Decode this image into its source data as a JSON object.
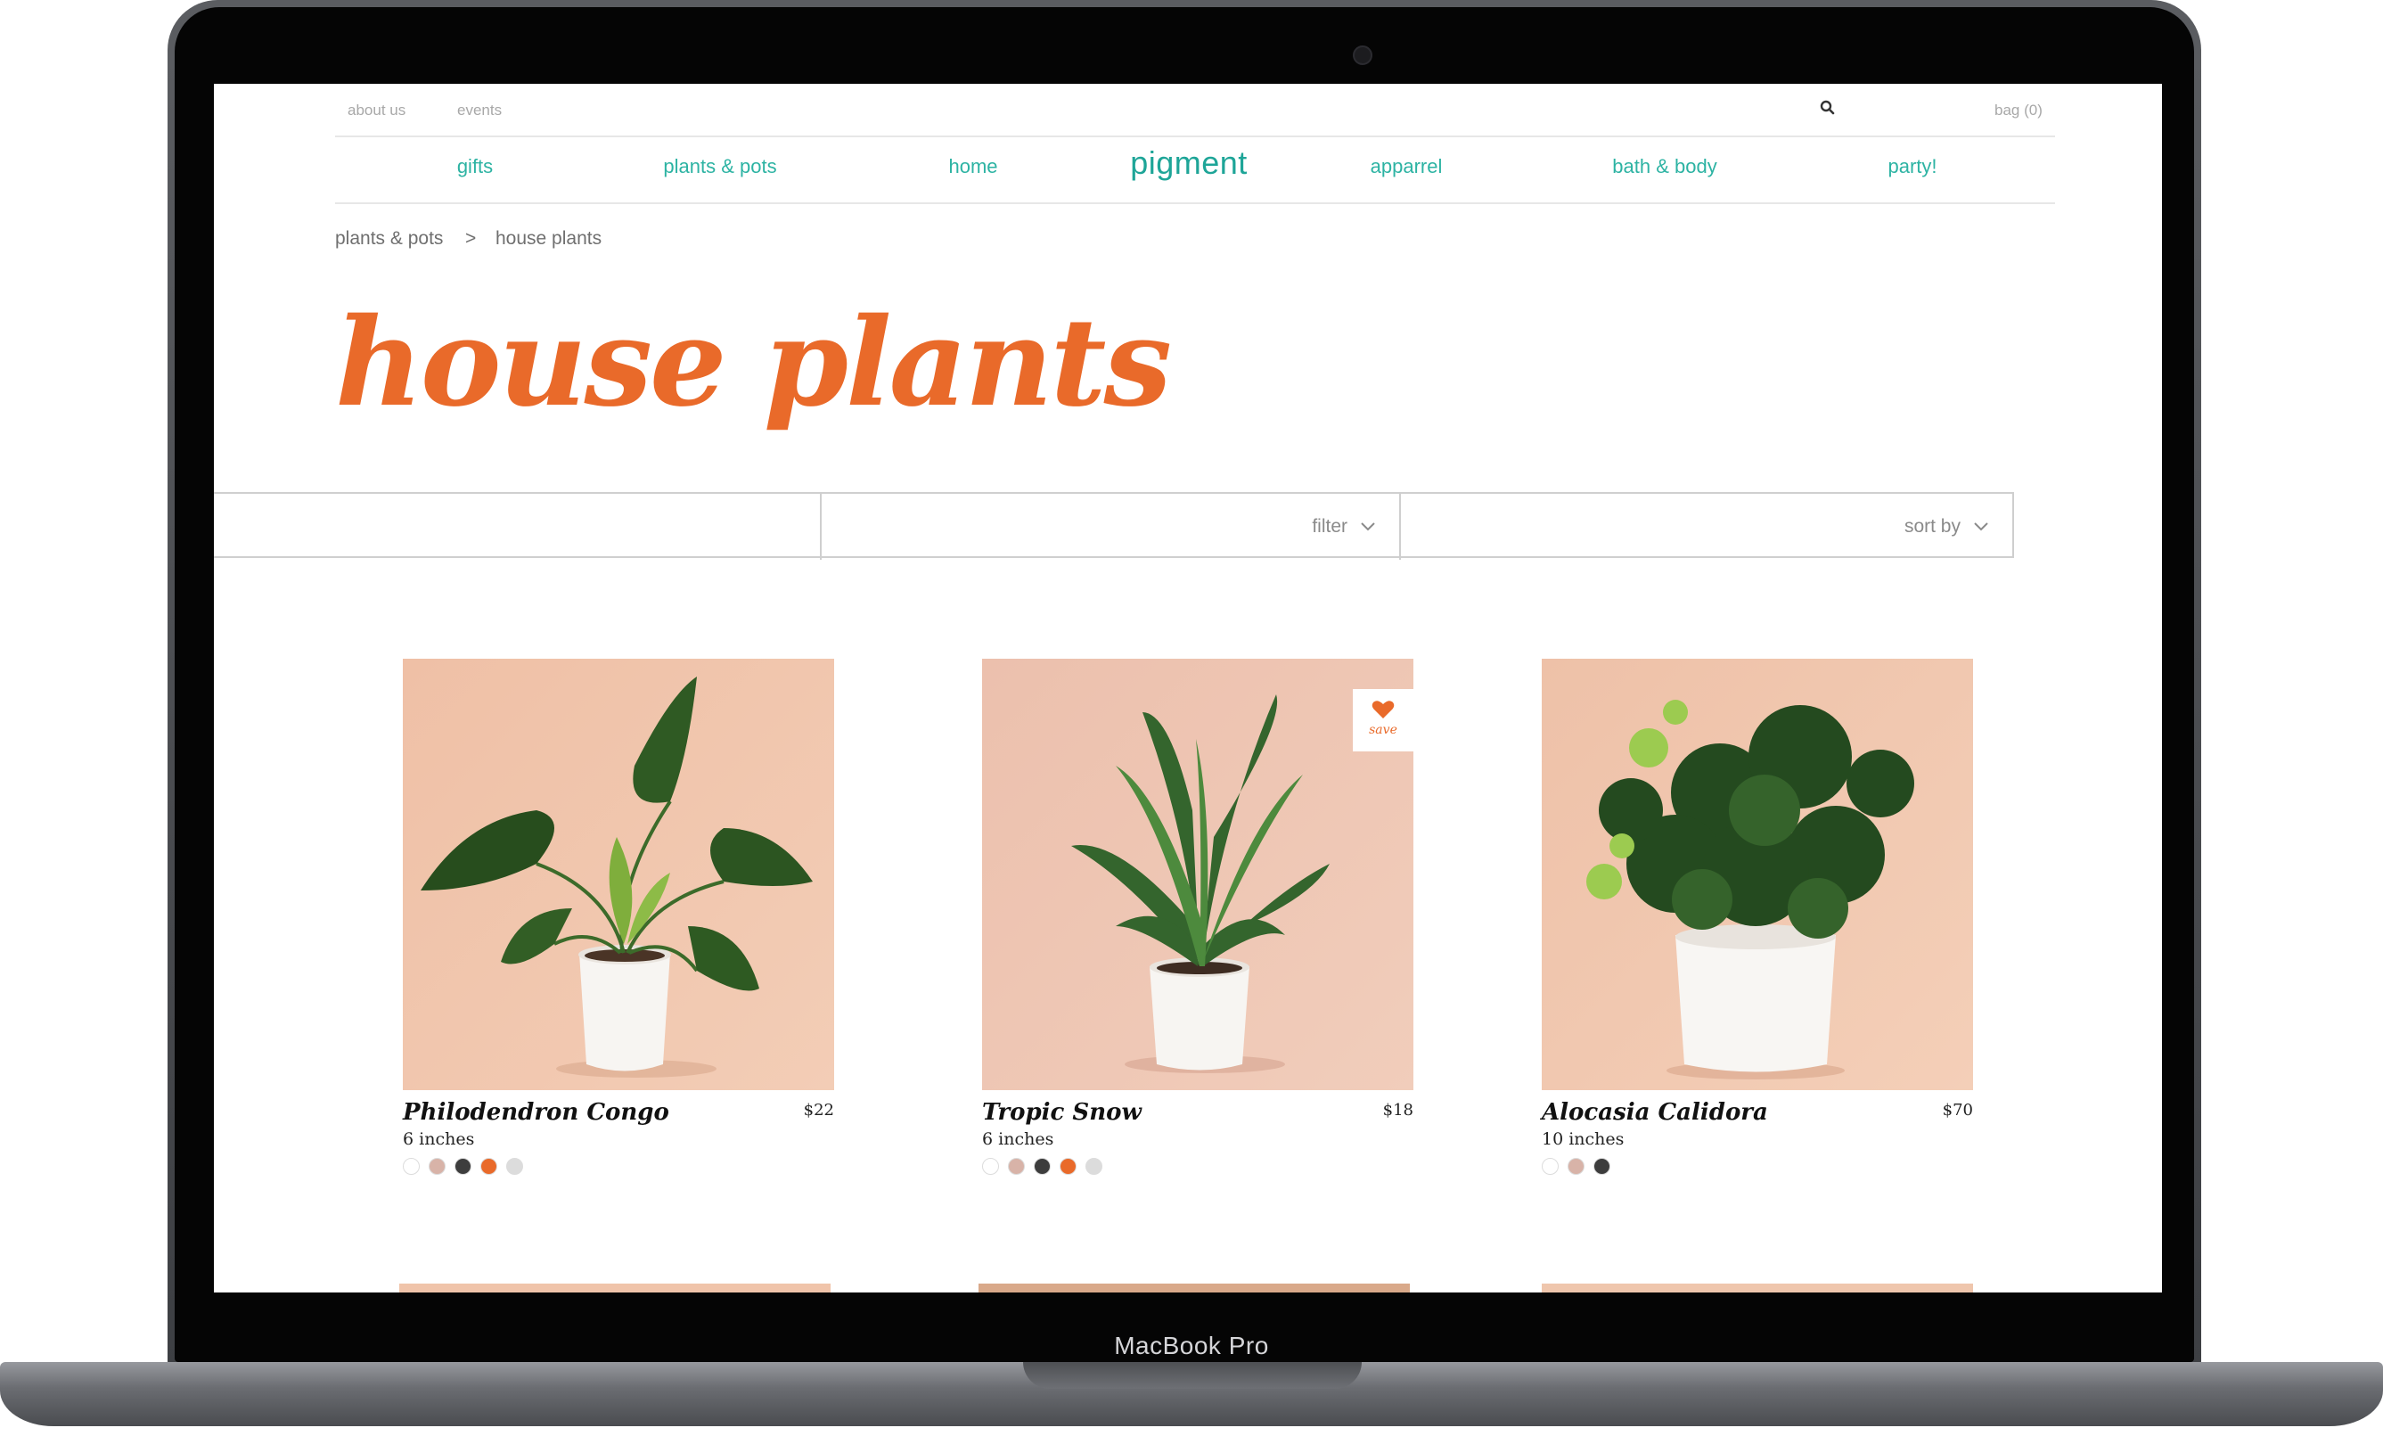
{
  "device": {
    "label": "MacBook Pro"
  },
  "utility_nav": {
    "about_label": "about us",
    "events_label": "events",
    "bag_label": "bag (0)"
  },
  "main_nav": {
    "logo": "pigment",
    "items": [
      {
        "label": "gifts"
      },
      {
        "label": "plants & pots"
      },
      {
        "label": "home"
      },
      {
        "label": "apparrel"
      },
      {
        "label": "bath & body"
      },
      {
        "label": "party!"
      }
    ]
  },
  "breadcrumb": {
    "items": [
      "plants & pots",
      "house plants"
    ],
    "separator": ">"
  },
  "page_title": "house plants",
  "toolbar": {
    "filter_label": "filter",
    "sort_label": "sort by"
  },
  "products": [
    {
      "name": "Philodendron Congo",
      "price": "$22",
      "size": "6 inches",
      "saved": false,
      "swatches": [
        "#ffffff",
        "#d8b3a8",
        "#3d3d3d",
        "#e96a2a",
        "#dcdcdc"
      ]
    },
    {
      "name": "Tropic Snow",
      "price": "$18",
      "size": "6 inches",
      "saved": true,
      "save_label": "save",
      "swatches": [
        "#ffffff",
        "#d8b3a8",
        "#3d3d3d",
        "#e96a2a",
        "#dcdcdc"
      ]
    },
    {
      "name": "Alocasia Calidora",
      "price": "$70",
      "size": "10 inches",
      "saved": false,
      "swatches": [
        "#ffffff",
        "#d8b3a8",
        "#3d3d3d"
      ]
    }
  ],
  "colors": {
    "accent_orange": "#e96a2a",
    "brand_teal": "#2db3a3",
    "photo_background": "#f0c5ad"
  }
}
